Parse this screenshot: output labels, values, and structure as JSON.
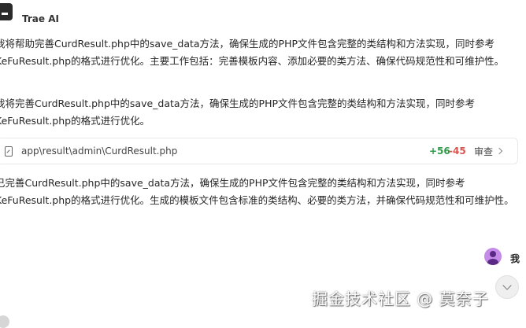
{
  "assistant": {
    "name": "Trae AI",
    "avatar_icon": "trae-logo-icon"
  },
  "messages": [
    "我将帮助完善CurdResult.php中的save_data方法，确保生成的PHP文件包含完整的类结构和方法实现，同时参考KeFuResult.php的格式进行优化。主要工作包括：完善模板内容、添加必要的类方法、确保代码规范性和可维护性。",
    "我将完善CurdResult.php中的save_data方法，确保生成的PHP文件包含完整的类结构和方法实现，同时参考KeFuResult.php的格式进行优化。",
    "已完善CurdResult.php中的save_data方法，确保生成的PHP文件包含完整的类结构和方法实现，同时参考KeFuResult.php的格式进行优化。生成的模板文件包含标准的类结构、必要的类方法，并确保代码规范性和可维护性。"
  ],
  "file_change": {
    "path": "app\\result\\admin\\CurdResult.php",
    "additions": "+56",
    "deletions": "-45",
    "review_label": "审查",
    "colors": {
      "additions": "#2e9a4a",
      "deletions": "#d9534f"
    }
  },
  "user": {
    "name": "我",
    "avatar_color": "#c58be8"
  },
  "watermark": "掘金技术社区 @ 莫奈子"
}
